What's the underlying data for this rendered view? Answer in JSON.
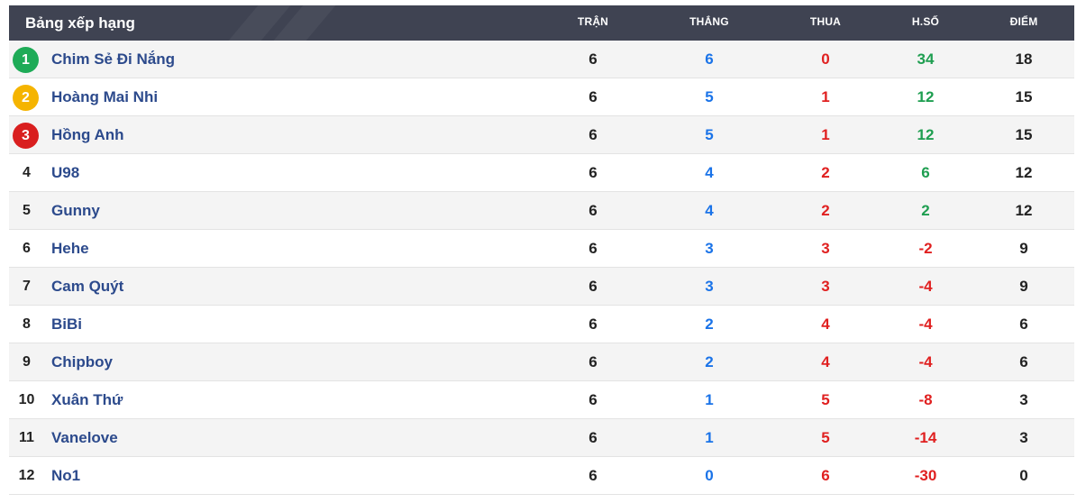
{
  "title": "Bảng xếp hạng",
  "columns": {
    "played": "TRẬN",
    "won": "THẮNG",
    "lost": "THUA",
    "diff": "H.SỐ",
    "points": "ĐIỂM"
  },
  "colors": {
    "header_bg": "#3f4352",
    "gold": "#1eab57",
    "silver": "#f5b400",
    "bronze": "#d91f1f",
    "name": "#2c4a8c",
    "won": "#1a73e8",
    "lost": "#e02020",
    "diff_positive": "#1e9e50",
    "diff_negative": "#e02020"
  },
  "rows": [
    {
      "rank": "1",
      "name": "Chim Sẻ Đi Nắng",
      "played": "6",
      "won": "6",
      "lost": "0",
      "diff": "34",
      "points": "18"
    },
    {
      "rank": "2",
      "name": "Hoàng Mai Nhi",
      "played": "6",
      "won": "5",
      "lost": "1",
      "diff": "12",
      "points": "15"
    },
    {
      "rank": "3",
      "name": "Hồng Anh",
      "played": "6",
      "won": "5",
      "lost": "1",
      "diff": "12",
      "points": "15"
    },
    {
      "rank": "4",
      "name": "U98",
      "played": "6",
      "won": "4",
      "lost": "2",
      "diff": "6",
      "points": "12"
    },
    {
      "rank": "5",
      "name": "Gunny",
      "played": "6",
      "won": "4",
      "lost": "2",
      "diff": "2",
      "points": "12"
    },
    {
      "rank": "6",
      "name": "Hehe",
      "played": "6",
      "won": "3",
      "lost": "3",
      "diff": "-2",
      "points": "9"
    },
    {
      "rank": "7",
      "name": "Cam Quýt",
      "played": "6",
      "won": "3",
      "lost": "3",
      "diff": "-4",
      "points": "9"
    },
    {
      "rank": "8",
      "name": "BiBi",
      "played": "6",
      "won": "2",
      "lost": "4",
      "diff": "-4",
      "points": "6"
    },
    {
      "rank": "9",
      "name": "Chipboy",
      "played": "6",
      "won": "2",
      "lost": "4",
      "diff": "-4",
      "points": "6"
    },
    {
      "rank": "10",
      "name": "Xuân Thứ",
      "played": "6",
      "won": "1",
      "lost": "5",
      "diff": "-8",
      "points": "3"
    },
    {
      "rank": "11",
      "name": "Vanelove",
      "played": "6",
      "won": "1",
      "lost": "5",
      "diff": "-14",
      "points": "3"
    },
    {
      "rank": "12",
      "name": "No1",
      "played": "6",
      "won": "0",
      "lost": "6",
      "diff": "-30",
      "points": "0"
    }
  ]
}
